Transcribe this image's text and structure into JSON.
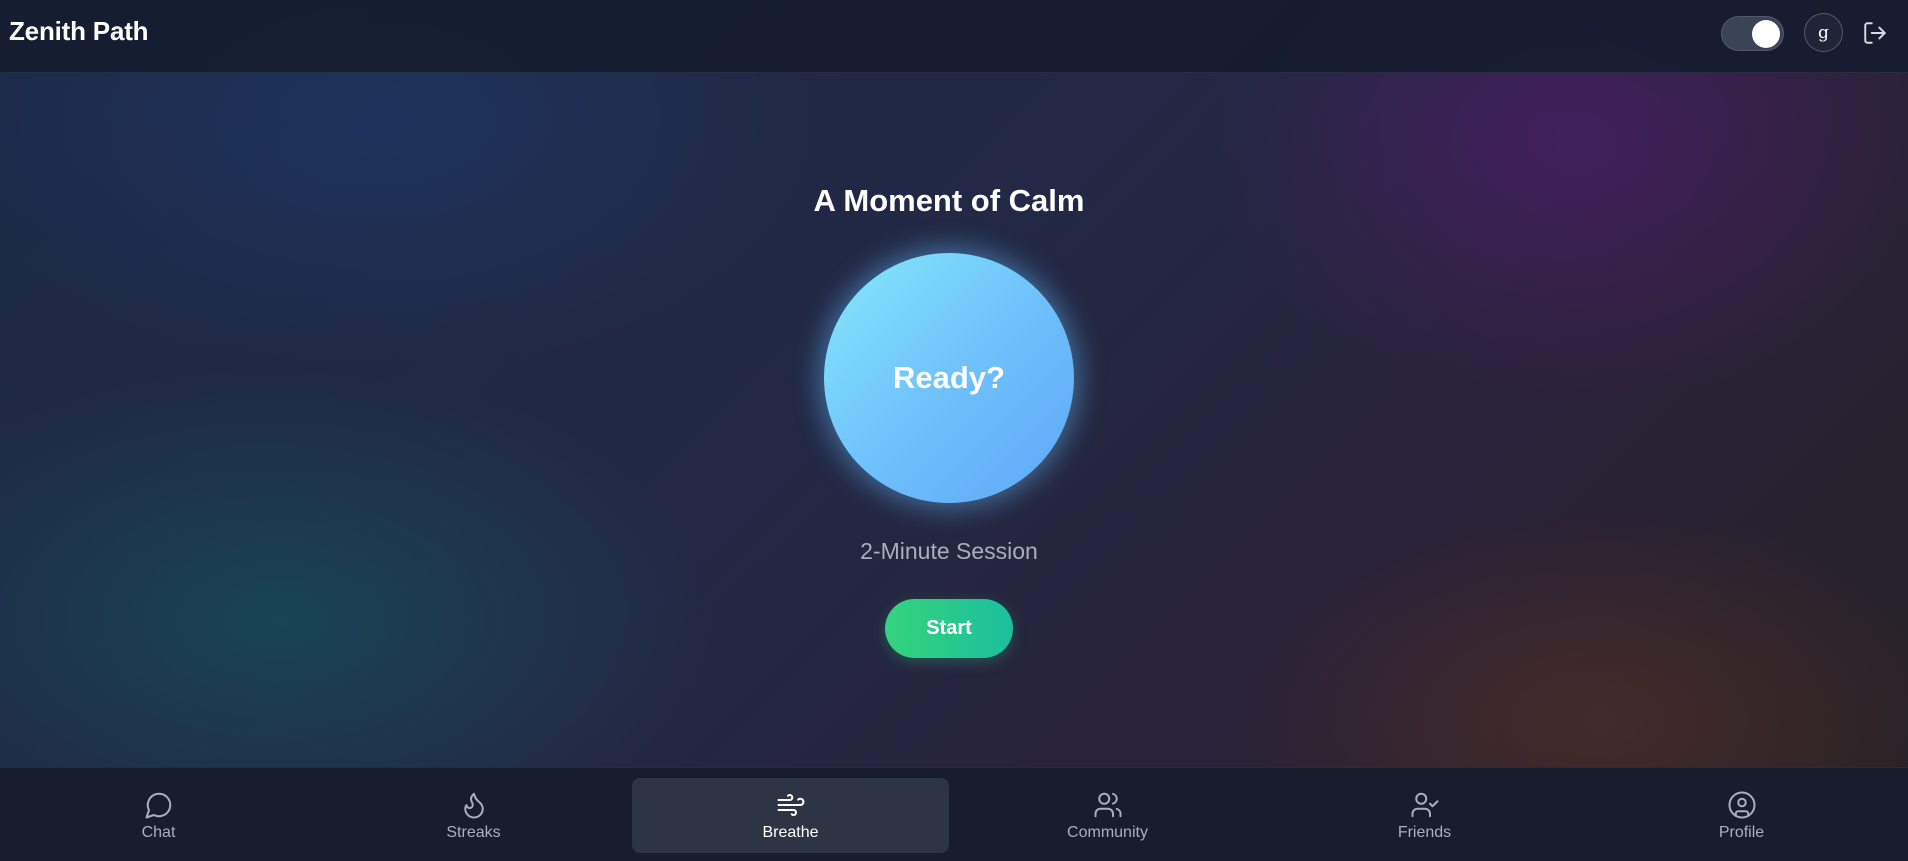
{
  "header": {
    "app_title": "Zenith Path",
    "avatar_initial": "g",
    "theme_toggle_on": true
  },
  "main": {
    "title": "A Moment of Calm",
    "circle_label": "Ready?",
    "session_label": "2-Minute Session",
    "start_label": "Start"
  },
  "nav": {
    "active": "Breathe",
    "items": [
      {
        "label": "Chat",
        "icon": "chat-bubble-icon"
      },
      {
        "label": "Streaks",
        "icon": "flame-icon"
      },
      {
        "label": "Breathe",
        "icon": "wind-icon"
      },
      {
        "label": "Community",
        "icon": "users-icon"
      },
      {
        "label": "Friends",
        "icon": "user-check-icon"
      },
      {
        "label": "Profile",
        "icon": "user-circle-icon"
      }
    ]
  },
  "colors": {
    "accent_start": "#34d37c",
    "accent_end": "#1cbf9c",
    "circle_top": "#86e8fb",
    "circle_bottom": "#5ea6f8",
    "nav_active_bg": "#2d3545"
  }
}
